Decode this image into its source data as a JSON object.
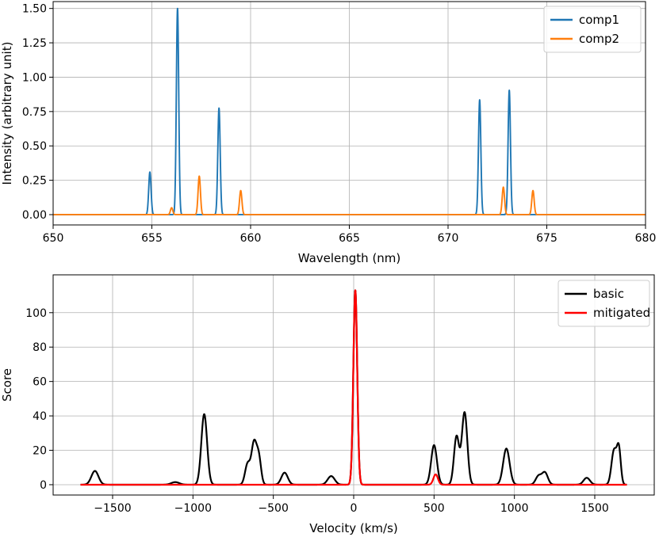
{
  "chart_data": [
    {
      "type": "line",
      "xlabel": "Wavelength (nm)",
      "ylabel": "Intensity (arbitrary unit)",
      "xlim": [
        650,
        680
      ],
      "ylim": [
        -0.075,
        1.55
      ],
      "xticks": [
        650,
        655,
        660,
        665,
        670,
        675,
        680
      ],
      "xtick_labels": [
        "650",
        "655",
        "660",
        "665",
        "670",
        "675",
        "680"
      ],
      "yticks": [
        0.0,
        0.25,
        0.5,
        0.75,
        1.0,
        1.25,
        1.5
      ],
      "ytick_labels": [
        "0.00",
        "0.25",
        "0.50",
        "0.75",
        "1.00",
        "1.25",
        "1.50"
      ],
      "grid": true,
      "legend": "top-right",
      "series": [
        {
          "name": "comp1",
          "color": "#1f77b4",
          "width": 0.06,
          "peaks": [
            [
              654.9,
              0.31
            ],
            [
              656.3,
              1.5
            ],
            [
              658.4,
              0.775
            ],
            [
              671.6,
              0.835
            ],
            [
              673.1,
              0.905
            ]
          ]
        },
        {
          "name": "comp2",
          "color": "#ff7f0e",
          "width": 0.06,
          "peaks": [
            [
              656.0,
              0.05
            ],
            [
              657.4,
              0.28
            ],
            [
              659.5,
              0.175
            ],
            [
              672.8,
              0.2
            ],
            [
              674.3,
              0.175
            ]
          ]
        }
      ]
    },
    {
      "type": "line",
      "xlabel": "Velocity (km/s)",
      "ylabel": "Score",
      "xlim": [
        -1870,
        1870
      ],
      "ylim": [
        -6,
        122
      ],
      "xticks": [
        -1500,
        -1000,
        -500,
        0,
        500,
        1000,
        1500
      ],
      "xtick_labels": [
        "−1500",
        "−1000",
        "−500",
        "0",
        "500",
        "1000",
        "1500"
      ],
      "yticks": [
        0,
        20,
        40,
        60,
        80,
        100
      ],
      "ytick_labels": [
        "0",
        "20",
        "40",
        "60",
        "80",
        "100"
      ],
      "grid": true,
      "legend": "top-right",
      "x_range": [
        -1700,
        1700
      ],
      "series": [
        {
          "name": "basic",
          "color": "#000000",
          "peaks": [
            [
              -1610,
              8,
              22
            ],
            [
              -1110,
              1.5,
              25
            ],
            [
              -930,
              41,
              18
            ],
            [
              -660,
              12,
              16
            ],
            [
              -620,
              24,
              16
            ],
            [
              -590,
              15,
              14
            ],
            [
              -430,
              7,
              20
            ],
            [
              -140,
              5,
              22
            ],
            [
              10,
              113,
              12
            ],
            [
              500,
              23,
              18
            ],
            [
              640,
              28,
              16
            ],
            [
              690,
              42,
              17
            ],
            [
              950,
              21,
              20
            ],
            [
              1150,
              5,
              18
            ],
            [
              1190,
              7,
              18
            ],
            [
              1450,
              4,
              20
            ],
            [
              1620,
              20,
              16
            ],
            [
              1650,
              20,
              12
            ]
          ]
        },
        {
          "name": "mitigated",
          "color": "#ff0000",
          "peaks": [
            [
              10,
              113,
              12
            ],
            [
              510,
              6,
              14
            ]
          ]
        }
      ]
    }
  ]
}
